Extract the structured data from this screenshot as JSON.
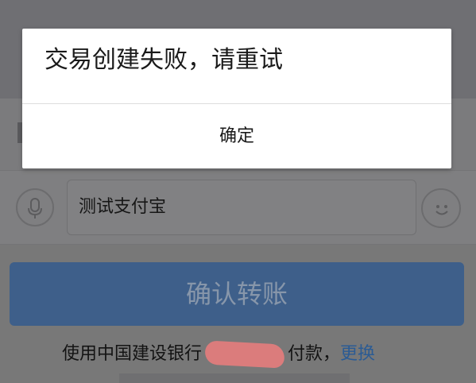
{
  "dialog": {
    "message": "交易创建失败，请重试",
    "ok_label": "确定"
  },
  "transfer": {
    "note_value": "测试支付宝",
    "confirm_label": "确认转账",
    "pay_prefix": "使用中国建设银行",
    "pay_suffix": "付款，",
    "change_label": "更换"
  },
  "colors": {
    "primary_button": "#3e5f8a",
    "link": "#2b5b94",
    "overlay": "#787878"
  },
  "icons": [
    "microphone-icon",
    "emoji-icon"
  ]
}
